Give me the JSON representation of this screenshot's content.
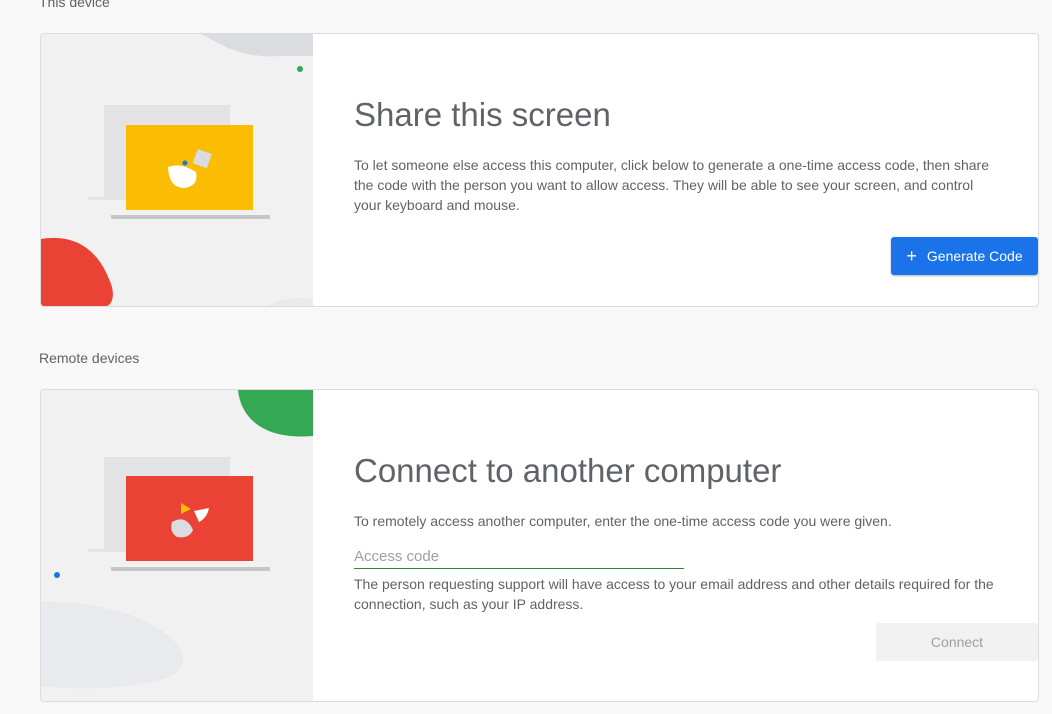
{
  "this_device": {
    "section_label": "This device",
    "title": "Share this screen",
    "description": "To let someone else access this computer, click below to generate a one-time access code, then share the code with the person you want to allow access. They will be able to see your screen, and control your keyboard and mouse.",
    "button_label": "Generate Code",
    "button_icon": "plus-icon"
  },
  "remote_devices": {
    "section_label": "Remote devices",
    "title": "Connect to another computer",
    "description": "To remotely access another computer, enter the one-time access code you were given.",
    "input_placeholder": "Access code",
    "input_value": "",
    "note": "The person requesting support will have access to your email address and other details required for the connection, such as your IP address.",
    "button_label": "Connect"
  },
  "colors": {
    "accent": "#1a73e8",
    "yellow": "#fbbc04",
    "red": "#ea4335",
    "green": "#34a853"
  }
}
